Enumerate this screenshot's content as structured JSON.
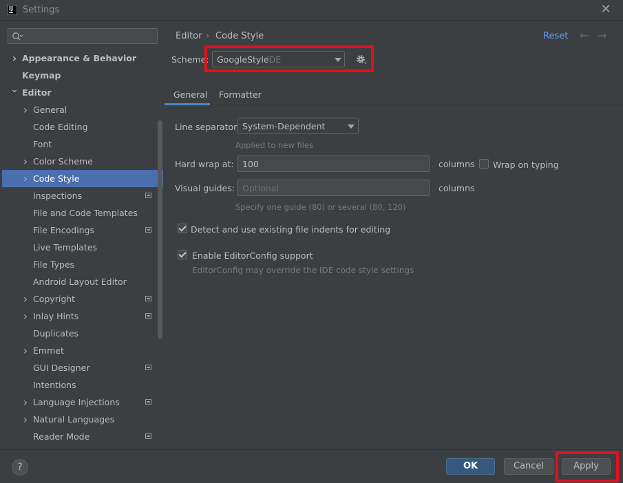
{
  "window": {
    "title": "Settings",
    "logo_text": "IJ"
  },
  "search": {
    "placeholder": ""
  },
  "sidebar": {
    "items": [
      {
        "label": "Appearance & Behavior",
        "level": 0,
        "chevron": "right",
        "bold": true
      },
      {
        "label": "Keymap",
        "level": 0,
        "chevron": "",
        "bold": true
      },
      {
        "label": "Editor",
        "level": 0,
        "chevron": "down",
        "bold": true
      },
      {
        "label": "General",
        "level": 1,
        "chevron": "right"
      },
      {
        "label": "Code Editing",
        "level": 1,
        "chevron": ""
      },
      {
        "label": "Font",
        "level": 1,
        "chevron": ""
      },
      {
        "label": "Color Scheme",
        "level": 1,
        "chevron": "right"
      },
      {
        "label": "Code Style",
        "level": 1,
        "chevron": "right",
        "selected": true
      },
      {
        "label": "Inspections",
        "level": 1,
        "chevron": "",
        "project_icon": true
      },
      {
        "label": "File and Code Templates",
        "level": 1,
        "chevron": ""
      },
      {
        "label": "File Encodings",
        "level": 1,
        "chevron": "",
        "project_icon": true
      },
      {
        "label": "Live Templates",
        "level": 1,
        "chevron": ""
      },
      {
        "label": "File Types",
        "level": 1,
        "chevron": ""
      },
      {
        "label": "Android Layout Editor",
        "level": 1,
        "chevron": ""
      },
      {
        "label": "Copyright",
        "level": 1,
        "chevron": "right",
        "project_icon": true
      },
      {
        "label": "Inlay Hints",
        "level": 1,
        "chevron": "right",
        "project_icon": true
      },
      {
        "label": "Duplicates",
        "level": 1,
        "chevron": ""
      },
      {
        "label": "Emmet",
        "level": 1,
        "chevron": "right"
      },
      {
        "label": "GUI Designer",
        "level": 1,
        "chevron": "",
        "project_icon": true
      },
      {
        "label": "Intentions",
        "level": 1,
        "chevron": ""
      },
      {
        "label": "Language Injections",
        "level": 1,
        "chevron": "right",
        "project_icon": true
      },
      {
        "label": "Natural Languages",
        "level": 1,
        "chevron": "right"
      },
      {
        "label": "Reader Mode",
        "level": 1,
        "chevron": "",
        "project_icon": true
      }
    ]
  },
  "header": {
    "breadcrumb_parent": "Editor",
    "breadcrumb_sep": "›",
    "breadcrumb_current": "Code Style",
    "reset_label": "Reset",
    "back_arrow": "←",
    "forward_arrow": "→"
  },
  "scheme": {
    "label": "Scheme:",
    "value": "GoogleStyle",
    "sub": "IDE"
  },
  "tabs": [
    {
      "label": "General",
      "active": true
    },
    {
      "label": "Formatter"
    }
  ],
  "general": {
    "line_separator_label": "Line separator:",
    "line_separator_value": "System-Dependent",
    "line_separator_hint": "Applied to new files",
    "hard_wrap_label": "Hard wrap at:",
    "hard_wrap_value": "100",
    "hard_wrap_unit": "columns",
    "wrap_on_typing_label": "Wrap on typing",
    "wrap_on_typing_checked": false,
    "visual_guides_label": "Visual guides:",
    "visual_guides_placeholder": "Optional",
    "visual_guides_unit": "columns",
    "visual_guides_hint": "Specify one guide (80) or several (80, 120)",
    "detect_indents_label": "Detect and use existing file indents for editing",
    "detect_indents_checked": true,
    "editorconfig_label": "Enable EditorConfig support",
    "editorconfig_checked": true,
    "editorconfig_hint": "EditorConfig may override the IDE code style settings"
  },
  "footer": {
    "help_label": "?",
    "ok_label": "OK",
    "cancel_label": "Cancel",
    "apply_label": "Apply"
  },
  "colors": {
    "background": "#3c3f41",
    "selection": "#4b6eaf",
    "link": "#589df6",
    "highlight": "#e3101c",
    "primary_button": "#365880"
  }
}
